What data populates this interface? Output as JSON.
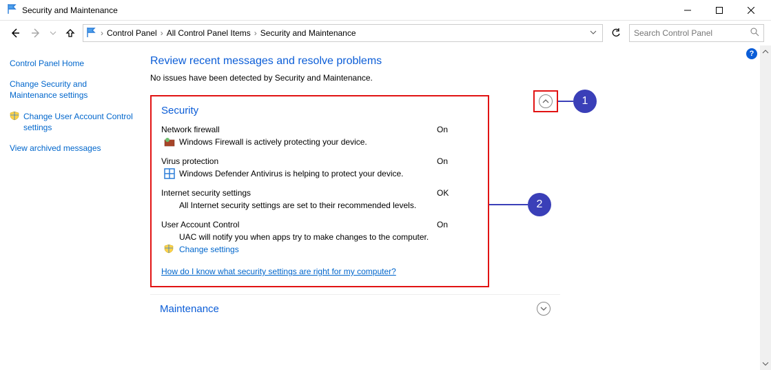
{
  "window": {
    "title": "Security and Maintenance",
    "controls": {
      "min": "minimize",
      "max": "maximize",
      "close": "close"
    }
  },
  "nav": {
    "crumbs": [
      "Control Panel",
      "All Control Panel Items",
      "Security and Maintenance"
    ],
    "refresh": "refresh",
    "search_placeholder": "Search Control Panel"
  },
  "sidebar": {
    "home": "Control Panel Home",
    "change_secmaint": "Change Security and Maintenance settings",
    "change_uac": "Change User Account Control settings",
    "archived": "View archived messages"
  },
  "page": {
    "title": "Review recent messages and resolve problems",
    "subtext": "No issues have been detected by Security and Maintenance."
  },
  "security": {
    "heading": "Security",
    "firewall": {
      "name": "Network firewall",
      "status": "On",
      "desc": "Windows Firewall is actively protecting your device."
    },
    "virus": {
      "name": "Virus protection",
      "status": "On",
      "desc": "Windows Defender Antivirus is helping to protect your device."
    },
    "internet": {
      "name": "Internet security settings",
      "status": "OK",
      "desc": "All Internet security settings are set to their recommended levels."
    },
    "uac": {
      "name": "User Account Control",
      "status": "On",
      "desc": "UAC will notify you when apps try to make changes to the computer.",
      "change_link": "Change settings"
    },
    "footer_link": "How do I know what security settings are right for my computer?"
  },
  "maintenance": {
    "heading": "Maintenance"
  },
  "annotations": {
    "one": "1",
    "two": "2"
  }
}
